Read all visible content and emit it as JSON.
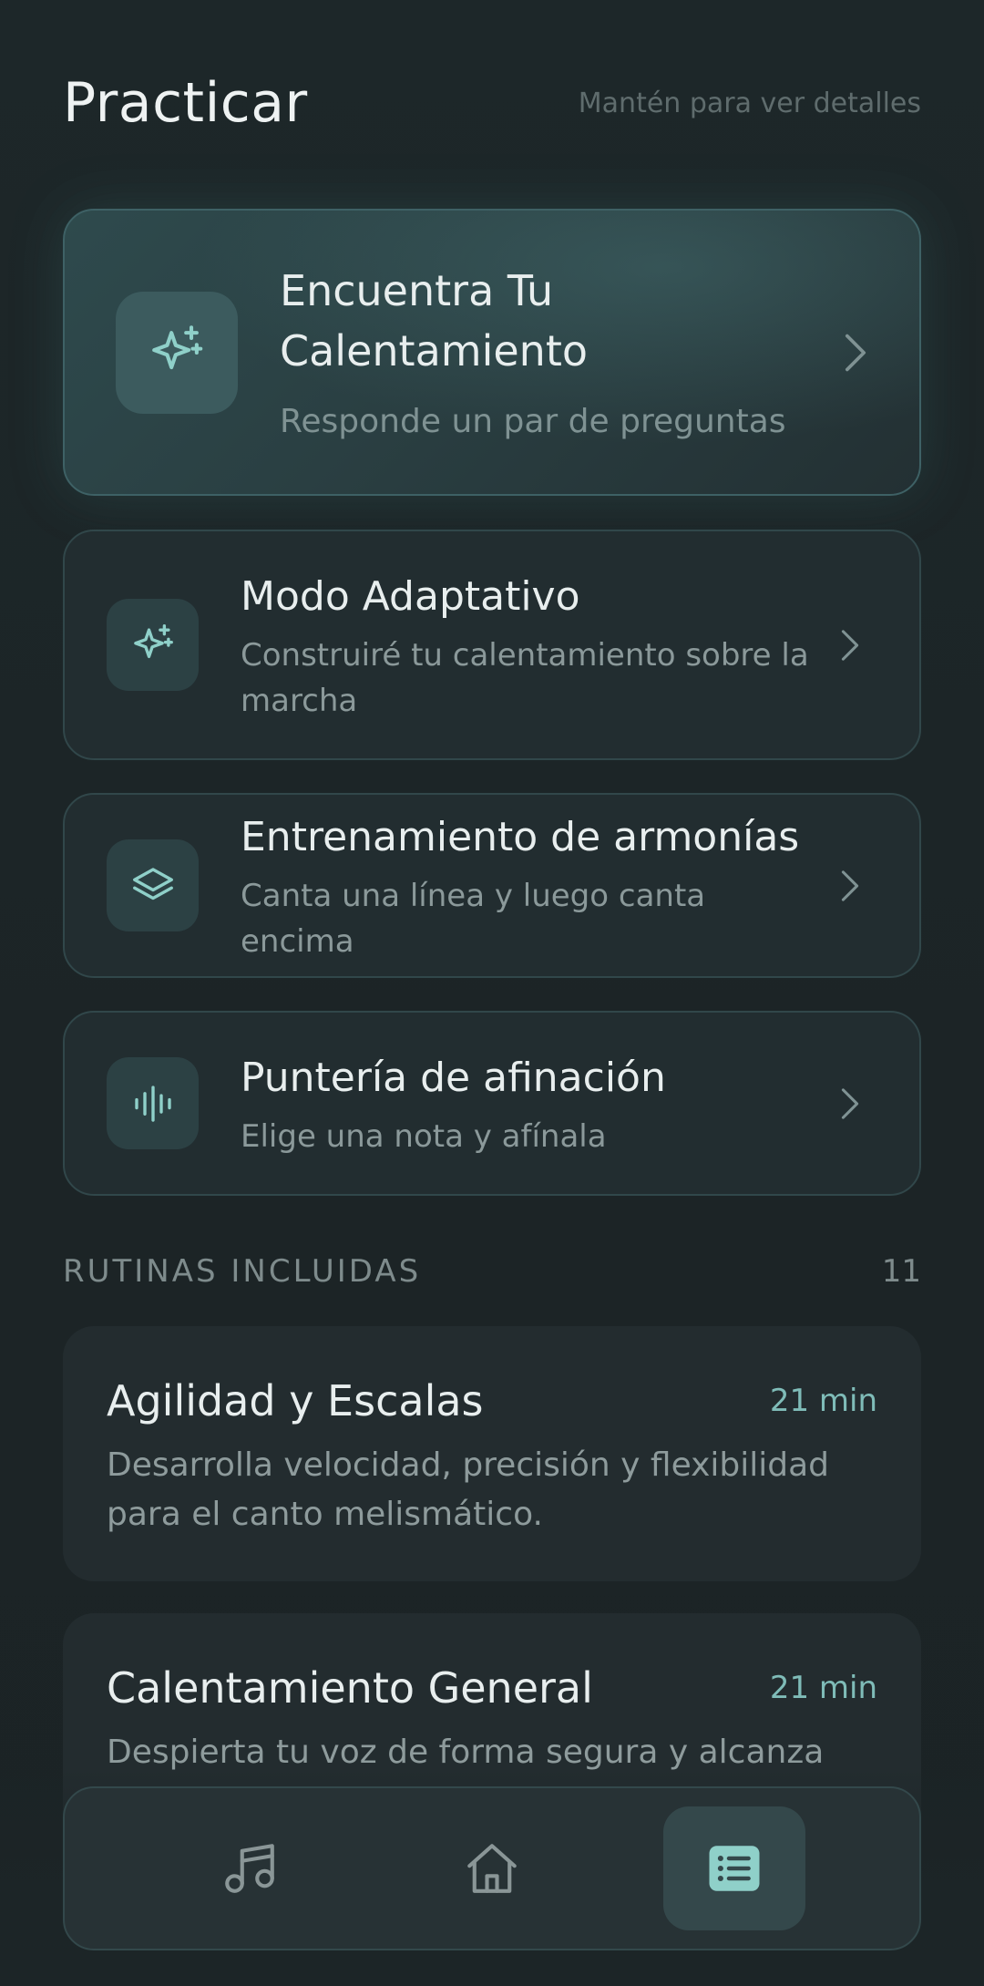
{
  "header": {
    "title": "Practicar",
    "hint": "Mantén para ver detalles"
  },
  "featured": {
    "title": "Encuentra Tu Calentamiento",
    "subtitle": "Responde un par de preguntas",
    "icon": "sparkles-icon"
  },
  "modes": [
    {
      "title": "Modo Adaptativo",
      "subtitle": "Construiré tu calentamiento sobre la marcha",
      "icon": "sparkles-icon"
    },
    {
      "title": "Entrenamiento de armonías",
      "subtitle": "Canta una línea y luego canta encima",
      "icon": "layers-icon"
    },
    {
      "title": "Puntería de afinación",
      "subtitle": "Elige una nota y afínala",
      "icon": "waveform-icon"
    }
  ],
  "routines_section": {
    "label": "RUTINAS INCLUIDAS",
    "count": "11"
  },
  "routines": [
    {
      "title": "Agilidad y Escalas",
      "duration": "21 min",
      "description": "Desarrolla velocidad, precisión y flexibilidad para el canto melismático."
    },
    {
      "title": "Calentamiento General",
      "duration": "21 min",
      "description": "Despierta tu voz de forma segura y alcanza"
    }
  ],
  "nav": {
    "items": [
      {
        "icon": "music-note-icon",
        "active": false
      },
      {
        "icon": "home-icon",
        "active": false
      },
      {
        "icon": "list-icon",
        "active": true
      }
    ]
  },
  "colors": {
    "background": "#1c2527",
    "accent": "#7fbcb8",
    "card": "#222d30"
  }
}
